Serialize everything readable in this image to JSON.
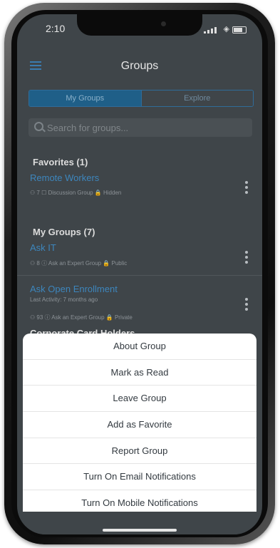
{
  "status_bar": {
    "time": "2:10"
  },
  "header": {
    "title": "Groups",
    "menu_icon": "hamburger-menu-icon"
  },
  "tabs": [
    {
      "label": "My Groups",
      "active": true
    },
    {
      "label": "Explore",
      "active": false
    }
  ],
  "search": {
    "placeholder": "Search for groups..."
  },
  "favorites": {
    "heading": "Favorites (1)",
    "groups": [
      {
        "name": "Remote Workers",
        "meta": "⚇ 7  ☐ Discussion Group  🔒 Hidden"
      }
    ]
  },
  "my_groups": {
    "heading": "My Groups (7)",
    "groups": [
      {
        "name": "Ask IT",
        "meta": "⚇ 8  ⓘ Ask an Expert Group  🔒 Public"
      },
      {
        "name": "Ask Open Enrollment",
        "activity": "Last Activity: 7 months ago",
        "meta": "⚇ 93  ⓘ Ask an Expert Group  🔒 Private"
      },
      {
        "name": "Corporate Card Holders"
      }
    ]
  },
  "action_sheet": {
    "items": [
      "About Group",
      "Mark as Read",
      "Leave Group",
      "Add as Favorite",
      "Report Group",
      "Turn On Email Notifications",
      "Turn On Mobile Notifications"
    ]
  },
  "colors": {
    "accent": "#3d86bd",
    "background": "#3f4549",
    "sheet": "#ffffff"
  }
}
